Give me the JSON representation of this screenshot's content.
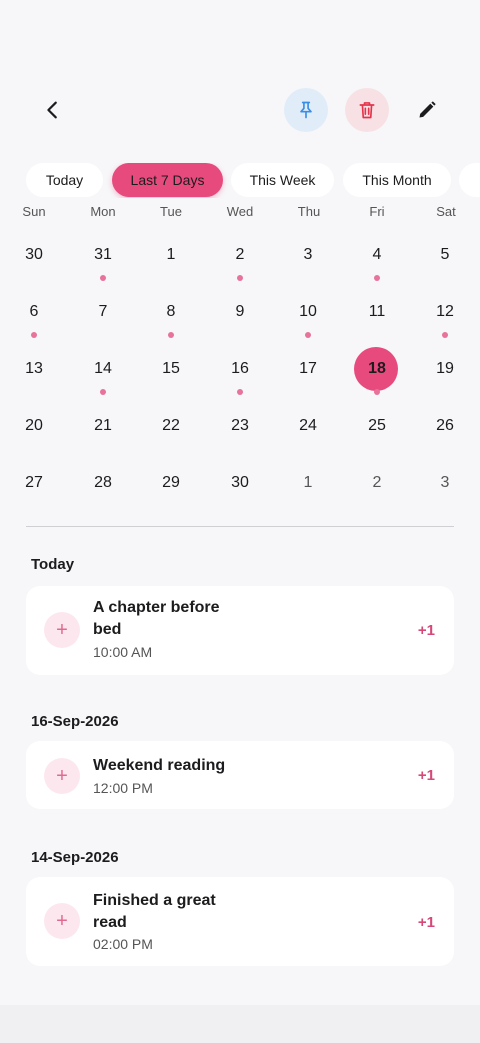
{
  "toolbar": {
    "back_icon": "chevron-left-icon",
    "pin_icon": "pin-icon",
    "delete_icon": "trash-icon",
    "edit_icon": "pencil-icon",
    "colors": {
      "pin_bg": "#e1ecf9",
      "pin_fg": "#3a8ee6",
      "delete_bg": "#f7e1e4",
      "delete_fg": "#e3344c"
    }
  },
  "filters": {
    "today": "Today",
    "last7": "Last 7 Days",
    "week": "This Week",
    "month": "This Month",
    "active": "Last 7 Days",
    "accent": "#e74b7d"
  },
  "calendar": {
    "weekdays": [
      "Sun",
      "Mon",
      "Tue",
      "Wed",
      "Thu",
      "Fri",
      "Sat"
    ],
    "weeks": [
      [
        {
          "d": "30",
          "m": false,
          "dot": false
        },
        {
          "d": "31",
          "m": false,
          "dot": true
        },
        {
          "d": "1",
          "m": false,
          "dot": false
        },
        {
          "d": "2",
          "m": false,
          "dot": true
        },
        {
          "d": "3",
          "m": false,
          "dot": false
        },
        {
          "d": "4",
          "m": false,
          "dot": true
        },
        {
          "d": "5",
          "m": false,
          "dot": false
        }
      ],
      [
        {
          "d": "6",
          "m": false,
          "dot": true
        },
        {
          "d": "7",
          "m": false,
          "dot": false
        },
        {
          "d": "8",
          "m": false,
          "dot": true
        },
        {
          "d": "9",
          "m": false,
          "dot": false
        },
        {
          "d": "10",
          "m": false,
          "dot": true
        },
        {
          "d": "11",
          "m": false,
          "dot": false
        },
        {
          "d": "12",
          "m": false,
          "dot": true
        }
      ],
      [
        {
          "d": "13",
          "m": false,
          "dot": false
        },
        {
          "d": "14",
          "m": false,
          "dot": true
        },
        {
          "d": "15",
          "m": false,
          "dot": false
        },
        {
          "d": "16",
          "m": false,
          "dot": true
        },
        {
          "d": "17",
          "m": false,
          "dot": false
        },
        {
          "d": "18",
          "m": false,
          "dot": true,
          "sel": true
        },
        {
          "d": "19",
          "m": false,
          "dot": false
        }
      ],
      [
        {
          "d": "20",
          "m": false,
          "dot": false
        },
        {
          "d": "21",
          "m": false,
          "dot": false
        },
        {
          "d": "22",
          "m": false,
          "dot": false
        },
        {
          "d": "23",
          "m": false,
          "dot": false
        },
        {
          "d": "24",
          "m": false,
          "dot": false
        },
        {
          "d": "25",
          "m": false,
          "dot": false
        },
        {
          "d": "26",
          "m": false,
          "dot": false
        }
      ],
      [
        {
          "d": "27",
          "m": false,
          "dot": false
        },
        {
          "d": "28",
          "m": false,
          "dot": false
        },
        {
          "d": "29",
          "m": false,
          "dot": false
        },
        {
          "d": "30",
          "m": false,
          "dot": false
        },
        {
          "d": "1",
          "m": true,
          "dot": false
        },
        {
          "d": "2",
          "m": true,
          "dot": false
        },
        {
          "d": "3",
          "m": true,
          "dot": false
        }
      ]
    ]
  },
  "entries": {
    "group1": {
      "title": "Today",
      "item": {
        "title": "A chapter before bed",
        "time": "10:00 AM",
        "count": "+1"
      }
    },
    "group2": {
      "title": "16-Sep-2026",
      "item": {
        "title": "Weekend reading",
        "time": "12:00 PM",
        "count": "+1"
      }
    },
    "group3": {
      "title": "14-Sep-2026",
      "item": {
        "title": "Finished a great read",
        "time": "02:00 PM",
        "count": "+1"
      }
    }
  }
}
